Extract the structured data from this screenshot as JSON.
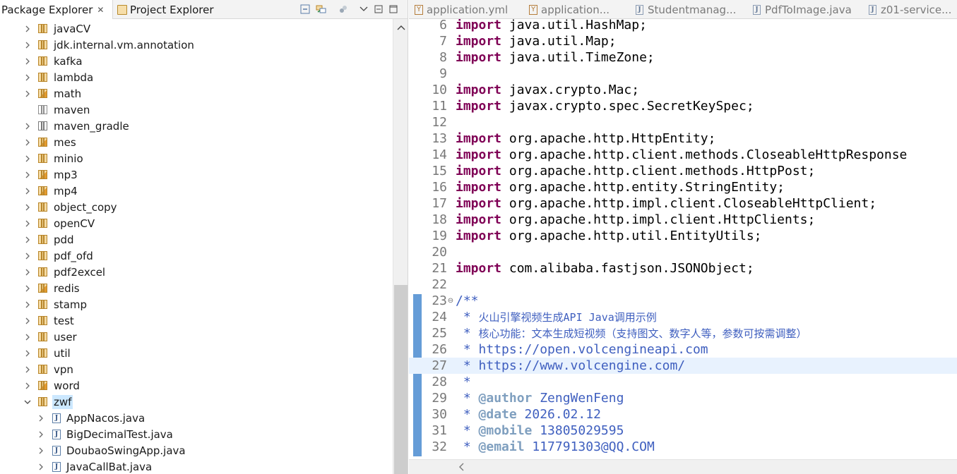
{
  "package_explorer": {
    "tabs": [
      {
        "label": "Package Explorer",
        "close": "✕"
      },
      {
        "label": "Project Explorer"
      }
    ],
    "tree": [
      {
        "label": "javaCV",
        "icon": "package",
        "expanded": false
      },
      {
        "label": "jdk.internal.vm.annotation",
        "icon": "package",
        "expanded": false
      },
      {
        "label": "kafka",
        "icon": "package",
        "expanded": false
      },
      {
        "label": "lambda",
        "icon": "package",
        "expanded": false
      },
      {
        "label": "math",
        "icon": "package-mixed",
        "expanded": false
      },
      {
        "label": "maven",
        "icon": "package-empty",
        "expanded": null
      },
      {
        "label": "maven_gradle",
        "icon": "package-flat",
        "expanded": false
      },
      {
        "label": "mes",
        "icon": "package-mixed",
        "expanded": false
      },
      {
        "label": "minio",
        "icon": "package",
        "expanded": false
      },
      {
        "label": "mp3",
        "icon": "package-mixed",
        "expanded": false
      },
      {
        "label": "mp4",
        "icon": "package-mixed",
        "expanded": false
      },
      {
        "label": "object_copy",
        "icon": "package",
        "expanded": false
      },
      {
        "label": "openCV",
        "icon": "package",
        "expanded": false
      },
      {
        "label": "pdd",
        "icon": "package",
        "expanded": false
      },
      {
        "label": "pdf_ofd",
        "icon": "package",
        "expanded": false
      },
      {
        "label": "pdf2excel",
        "icon": "package",
        "expanded": false
      },
      {
        "label": "redis",
        "icon": "package-mixed",
        "expanded": false
      },
      {
        "label": "stamp",
        "icon": "package",
        "expanded": false
      },
      {
        "label": "test",
        "icon": "package",
        "expanded": false
      },
      {
        "label": "user",
        "icon": "package",
        "expanded": false
      },
      {
        "label": "util",
        "icon": "package",
        "expanded": false
      },
      {
        "label": "vpn",
        "icon": "package",
        "expanded": false
      },
      {
        "label": "word",
        "icon": "package-mixed",
        "expanded": false
      },
      {
        "label": "zwf",
        "icon": "package",
        "expanded": true,
        "selected": true
      },
      {
        "label": "AppNacos.java",
        "icon": "java-file",
        "expanded": false,
        "child": true
      },
      {
        "label": "BigDecimalTest.java",
        "icon": "java-file",
        "expanded": false,
        "child": true
      },
      {
        "label": "DoubaoSwingApp.java",
        "icon": "java-file",
        "expanded": false,
        "child": true
      },
      {
        "label": "JavaCallBat.java",
        "icon": "java-file",
        "expanded": false,
        "child": true
      }
    ]
  },
  "editor": {
    "tabs": [
      {
        "label": "application.yml",
        "icon": "yml"
      },
      {
        "label": "application...",
        "icon": "yml"
      },
      {
        "label": "Studentmanag...",
        "icon": "java"
      },
      {
        "label": "PdfToImage.java",
        "icon": "java"
      },
      {
        "label": "z01-service...",
        "icon": "java"
      }
    ],
    "lines": [
      {
        "no": "6",
        "parts": [
          {
            "t": "import",
            "c": "kw"
          },
          {
            "t": " java.util.HashMap;"
          }
        ]
      },
      {
        "no": "7",
        "parts": [
          {
            "t": "import",
            "c": "kw"
          },
          {
            "t": " java.util.Map;"
          }
        ]
      },
      {
        "no": "8",
        "parts": [
          {
            "t": "import",
            "c": "kw"
          },
          {
            "t": " java.util.TimeZone;"
          }
        ]
      },
      {
        "no": "9",
        "parts": []
      },
      {
        "no": "10",
        "parts": [
          {
            "t": "import",
            "c": "kw"
          },
          {
            "t": " javax.crypto.Mac;"
          }
        ]
      },
      {
        "no": "11",
        "parts": [
          {
            "t": "import",
            "c": "kw"
          },
          {
            "t": " javax.crypto.spec.SecretKeySpec;"
          }
        ]
      },
      {
        "no": "12",
        "parts": []
      },
      {
        "no": "13",
        "parts": [
          {
            "t": "import",
            "c": "kw"
          },
          {
            "t": " org.apache.http.HttpEntity;"
          }
        ]
      },
      {
        "no": "14",
        "parts": [
          {
            "t": "import",
            "c": "kw"
          },
          {
            "t": " org.apache.http.client.methods.CloseableHttpResponse"
          }
        ]
      },
      {
        "no": "15",
        "parts": [
          {
            "t": "import",
            "c": "kw"
          },
          {
            "t": " org.apache.http.client.methods.HttpPost;"
          }
        ]
      },
      {
        "no": "16",
        "parts": [
          {
            "t": "import",
            "c": "kw"
          },
          {
            "t": " org.apache.http.entity.StringEntity;"
          }
        ]
      },
      {
        "no": "17",
        "parts": [
          {
            "t": "import",
            "c": "kw"
          },
          {
            "t": " org.apache.http.impl.client.CloseableHttpClient;"
          }
        ]
      },
      {
        "no": "18",
        "parts": [
          {
            "t": "import",
            "c": "kw"
          },
          {
            "t": " org.apache.http.impl.client.HttpClients;"
          }
        ]
      },
      {
        "no": "19",
        "parts": [
          {
            "t": "import",
            "c": "kw"
          },
          {
            "t": " org.apache.http.util.EntityUtils;"
          }
        ]
      },
      {
        "no": "20",
        "parts": []
      },
      {
        "no": "21",
        "parts": [
          {
            "t": "import",
            "c": "kw"
          },
          {
            "t": " com.alibaba.fastjson.JSONObject;"
          }
        ]
      },
      {
        "no": "22",
        "parts": []
      },
      {
        "no": "23",
        "fold": "⊖",
        "parts": [
          {
            "t": "/**",
            "c": "cm"
          }
        ]
      },
      {
        "no": "24",
        "parts": [
          {
            "t": " * ",
            "c": "cm"
          },
          {
            "t": "火山引擎视频生成API Java调用示例",
            "c": "cm cm-cjk"
          }
        ]
      },
      {
        "no": "25",
        "parts": [
          {
            "t": " * ",
            "c": "cm"
          },
          {
            "t": "核心功能：文本生成短视频（支持图文、数字人等，参数可按需调整）",
            "c": "cm cm-cjk"
          }
        ]
      },
      {
        "no": "26",
        "parts": [
          {
            "t": " * ",
            "c": "cm"
          },
          {
            "t": "https://open.volcengineapi.com",
            "c": "link"
          }
        ]
      },
      {
        "no": "27",
        "current": true,
        "parts": [
          {
            "t": " * ",
            "c": "cm"
          },
          {
            "t": "https://www.volcengine.com/",
            "c": "link"
          }
        ]
      },
      {
        "no": "28",
        "parts": [
          {
            "t": " *",
            "c": "cm"
          }
        ]
      },
      {
        "no": "29",
        "parts": [
          {
            "t": " * ",
            "c": "cm"
          },
          {
            "t": "@author",
            "c": "tag"
          },
          {
            "t": " ZengWenFeng",
            "c": "cm"
          }
        ]
      },
      {
        "no": "30",
        "parts": [
          {
            "t": " * ",
            "c": "cm"
          },
          {
            "t": "@date",
            "c": "tag"
          },
          {
            "t": " 2026.02.12",
            "c": "cm"
          }
        ]
      },
      {
        "no": "31",
        "parts": [
          {
            "t": " * ",
            "c": "cm"
          },
          {
            "t": "@mobile",
            "c": "tag"
          },
          {
            "t": " 13805029595",
            "c": "cm"
          }
        ]
      },
      {
        "no": "32",
        "parts": [
          {
            "t": " * ",
            "c": "cm"
          },
          {
            "t": "@email",
            "c": "tag"
          },
          {
            "t": " 117791303@QQ.COM",
            "c": "cm"
          }
        ]
      }
    ]
  },
  "icons": {
    "collapse_all": "collapse-all-icon",
    "link_editor": "link-with-editor-icon",
    "focus": "focus-on-task-icon",
    "view_menu": "view-menu-chevron-icon",
    "minimize": "minimize-icon",
    "maximize": "maximize-icon"
  },
  "colors": {
    "keyword": "#7f0055",
    "comment": "#3f5fbf",
    "javadoc_tag": "#7f9fbf",
    "selection": "#cce8ff",
    "current_line": "#e8f2fe"
  }
}
